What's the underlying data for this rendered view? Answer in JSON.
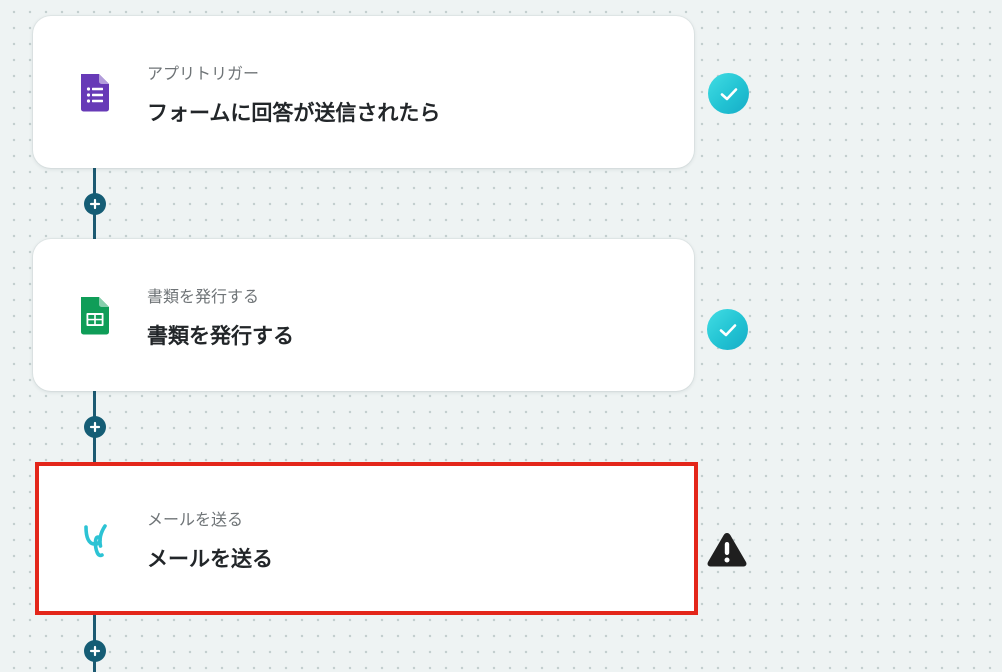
{
  "flow": {
    "steps": [
      {
        "subtitle": "アプリトリガー",
        "title": "フォームに回答が送信されたら",
        "icon": "google-forms-icon",
        "icon_color": "#673ab7",
        "status": "success"
      },
      {
        "subtitle": "書類を発行する",
        "title": "書類を発行する",
        "icon": "google-sheets-icon",
        "icon_color": "#0f9d58",
        "status": "success"
      },
      {
        "subtitle": "メールを送る",
        "title": "メールを送る",
        "icon": "yoom-mail-icon",
        "icon_color": "#2cc3d4",
        "status": "warning",
        "selected": true
      }
    ]
  },
  "colors": {
    "connector": "#1c5a72",
    "add_button": "#155d75",
    "check_badge": "#22c3d3",
    "warning_badge": "#1f1f1f",
    "selection_outline": "#e3261a",
    "canvas_background": "#eef3f3"
  },
  "icons": {
    "add_step": "plus-icon",
    "success": "check-icon",
    "warning": "warning-icon"
  }
}
